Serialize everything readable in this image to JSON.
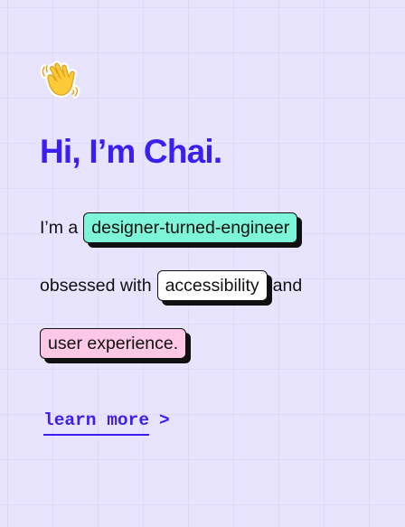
{
  "hero": {
    "wave_icon": "waving-hand-icon",
    "headline": "Hi, I’m Chai."
  },
  "intro": {
    "line1_prefix": "I’m a",
    "tag_role": "designer-turned-engineer",
    "line2_prefix": "obsessed with",
    "tag_accessibility": "accessibility",
    "line2_suffix": "and",
    "tag_ux": "user experience."
  },
  "cta": {
    "label": "learn more",
    "chevron": ">"
  },
  "colors": {
    "background": "#e9e4fd",
    "accent": "#3b1ff0",
    "tag_mint": "#7ef5d8",
    "tag_white": "#ffffff",
    "tag_pink": "#fcc8e6"
  }
}
